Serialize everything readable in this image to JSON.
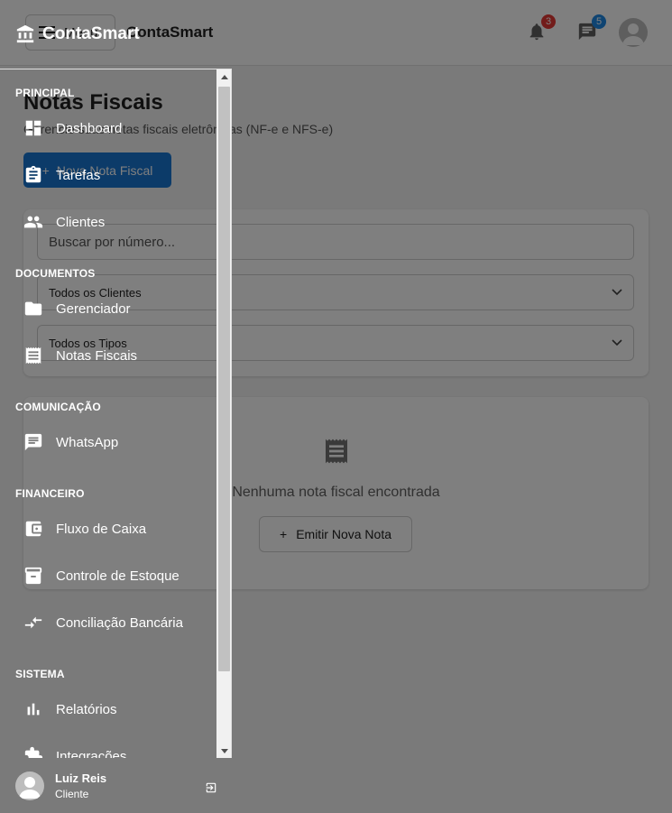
{
  "topbar": {
    "menu_label": "Menu",
    "title": "ContaSmart",
    "notifications_count": "3",
    "messages_count": "5"
  },
  "page": {
    "title": "Notas Fiscais",
    "subtitle": "Gerencie suas notas fiscais eletrônicas (NF-e e NFS-e)",
    "new_note_button": "Nova Nota Fiscal",
    "new_note_icon": "+"
  },
  "filters": {
    "search_placeholder": "Buscar por número...",
    "client_select": "Todos os Clientes",
    "type_select": "Todos os Tipos"
  },
  "empty_state": {
    "icon": "receipt-icon",
    "message": "Nenhuma nota fiscal encontrada",
    "button_icon": "+",
    "button_label": "Emitir Nova Nota"
  },
  "drawer": {
    "brand": "ContaSmart",
    "sections": {
      "principal": "PRINCIPAL",
      "documentos": "DOCUMENTOS",
      "comunicacao": "COMUNICAÇÃO",
      "financeiro": "FINANCEIRO",
      "sistema": "SISTEMA"
    },
    "items": {
      "dashboard": "Dashboard",
      "tarefas": "Tarefas",
      "clientes": "Clientes",
      "gerenciador": "Gerenciador",
      "notas_fiscais": "Notas Fiscais",
      "whatsapp": "WhatsApp",
      "fluxo_caixa": "Fluxo de Caixa",
      "estoque": "Controle de Estoque",
      "conciliacao": "Conciliação Bancária",
      "relatorios": "Relatórios",
      "integracoes": "Integrações"
    },
    "user": {
      "name": "Luiz Reis",
      "role": "Cliente"
    }
  },
  "colors": {
    "primary": "#1976d2",
    "overlay": "rgba(0,0,0,0.5)",
    "badge_red": "#e53935",
    "badge_blue": "#1e88e5"
  }
}
